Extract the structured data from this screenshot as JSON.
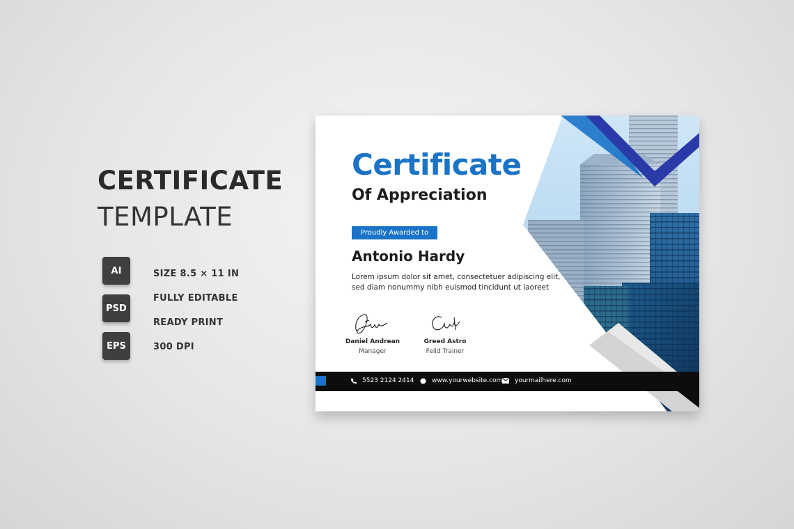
{
  "promo": {
    "title": "CERTIFICATE",
    "subtitle": "TEMPLATE",
    "formats": [
      "AI",
      "PSD",
      "EPS"
    ],
    "features": [
      "SIZE 8.5 × 11 IN",
      "FULLY EDITABLE",
      "READY PRINT",
      "300 DPI"
    ]
  },
  "certificate": {
    "title": "Certificate",
    "subtitle": "Of Appreciation",
    "award_label": "Proudly Awarded to",
    "recipient": "Antonio Hardy",
    "body": "Lorem ipsum dolor sit amet, consectetuer adipiscing elit, sed diam nonummy nibh euismod tincidunt ut laoreet",
    "signatures": [
      {
        "name": "Daniel Andrean",
        "role": "Manager"
      },
      {
        "name": "Greed Astro",
        "role": "Feild Trainer"
      }
    ],
    "footer": {
      "phone": "5523 2124 2414",
      "website": "www.yourwebsite.com",
      "email": "yourmailhere.com"
    },
    "colors": {
      "accent": "#1a73c7",
      "dark_blue": "#2a3aa8",
      "footer_bar": "#0d0d0d",
      "gray_stripe": "#d4d4d4"
    }
  }
}
